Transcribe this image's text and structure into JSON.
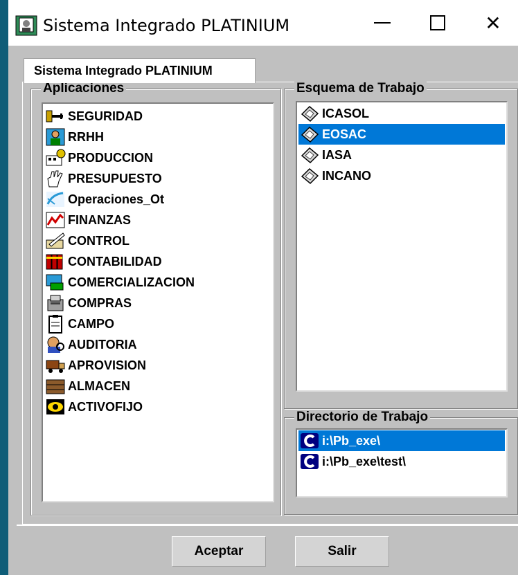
{
  "window": {
    "title": "Sistema Integrado PLATINIUM",
    "close_glyph": "✕"
  },
  "tab": {
    "label": "Sistema Integrado PLATINIUM"
  },
  "aplicaciones": {
    "label": "Aplicaciones",
    "items": [
      {
        "label": "SEGURIDAD",
        "icon": "key-icon"
      },
      {
        "label": "RRHH",
        "icon": "person-icon"
      },
      {
        "label": "PRODUCCION",
        "icon": "production-icon"
      },
      {
        "label": "PRESUPUESTO",
        "icon": "hand-icon"
      },
      {
        "label": "Operaciones_Ot",
        "icon": "operations-icon"
      },
      {
        "label": "FINANZAS",
        "icon": "finance-chart-icon"
      },
      {
        "label": "CONTROL",
        "icon": "control-pen-icon"
      },
      {
        "label": "CONTABILIDAD",
        "icon": "books-icon"
      },
      {
        "label": "COMERCIALIZACION",
        "icon": "commerce-icon"
      },
      {
        "label": "COMPRAS",
        "icon": "cash-register-icon"
      },
      {
        "label": "CAMPO",
        "icon": "clipboard-icon"
      },
      {
        "label": "AUDITORIA",
        "icon": "auditor-icon"
      },
      {
        "label": "APROVISION",
        "icon": "truck-icon"
      },
      {
        "label": "ALMACEN",
        "icon": "warehouse-icon"
      },
      {
        "label": "ACTIVOFIJO",
        "icon": "eye-icon"
      }
    ]
  },
  "esquema": {
    "label": "Esquema de Trabajo",
    "items": [
      {
        "label": "ICASOL",
        "selected": false
      },
      {
        "label": "EOSAC",
        "selected": true
      },
      {
        "label": "IASA",
        "selected": false
      },
      {
        "label": "INCANO",
        "selected": false
      }
    ]
  },
  "directorio": {
    "label": "Directorio de Trabajo",
    "items": [
      {
        "label": "i:\\Pb_exe\\",
        "selected": true
      },
      {
        "label": "i:\\Pb_exe\\test\\",
        "selected": false
      }
    ]
  },
  "buttons": {
    "accept": "Aceptar",
    "exit": "Salir"
  },
  "colors": {
    "selection": "#0078d7",
    "window_border": "#0f5d78",
    "face": "#c0c0c0"
  }
}
